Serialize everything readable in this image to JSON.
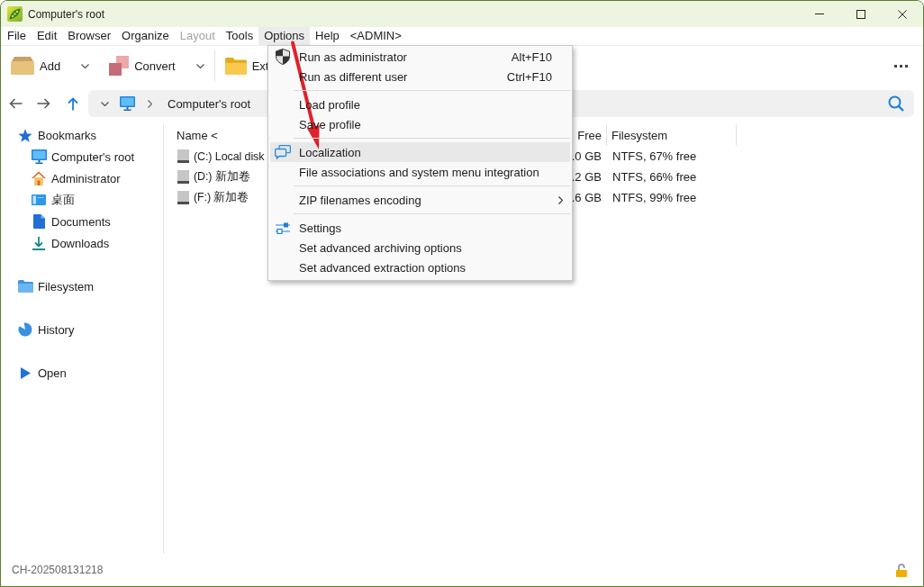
{
  "window": {
    "title": "Computer's root"
  },
  "menu_bar": [
    {
      "label": "File",
      "selected": false,
      "disabled": false
    },
    {
      "label": "Edit",
      "selected": false,
      "disabled": false
    },
    {
      "label": "Browser",
      "selected": false,
      "disabled": false
    },
    {
      "label": "Organize",
      "selected": false,
      "disabled": false
    },
    {
      "label": "Layout",
      "selected": false,
      "disabled": true
    },
    {
      "label": "Tools",
      "selected": false,
      "disabled": false
    },
    {
      "label": "Options",
      "selected": true,
      "disabled": false
    },
    {
      "label": "Help",
      "selected": false,
      "disabled": false
    },
    {
      "label": "<ADMIN>",
      "selected": false,
      "disabled": false
    }
  ],
  "open_menu": {
    "groups": [
      {
        "items": [
          {
            "label": "Run as administrator",
            "shortcut": "Alt+F10",
            "selected": false,
            "submenu": false
          },
          {
            "label": "Run as different user",
            "shortcut": "Ctrl+F10",
            "selected": false,
            "submenu": false
          }
        ]
      },
      {
        "items": [
          {
            "label": "Load profile",
            "selected": false,
            "submenu": false
          },
          {
            "label": "Save profile",
            "selected": false,
            "submenu": false
          }
        ]
      },
      {
        "items": [
          {
            "label": "Localization",
            "selected": true,
            "submenu": false
          },
          {
            "label": "File associations and system menu integration",
            "selected": false,
            "submenu": false
          }
        ]
      },
      {
        "items": [
          {
            "label": "ZIP filenames encoding",
            "selected": false,
            "submenu": true
          }
        ]
      },
      {
        "items": [
          {
            "label": "Settings",
            "selected": false,
            "submenu": false
          },
          {
            "label": "Set advanced archiving options",
            "selected": false,
            "submenu": false
          },
          {
            "label": "Set advanced extraction options",
            "selected": false,
            "submenu": false
          }
        ]
      }
    ]
  },
  "annotations": [
    {
      "kind": "arrow"
    }
  ],
  "toolbar": {
    "groups": [
      {
        "buttons": [
          {
            "label": "Add",
            "dropdown": true
          },
          {
            "label": "Convert",
            "dropdown": true
          }
        ]
      },
      {
        "buttons": [
          {
            "label": "Ext",
            "dropdown": false
          }
        ]
      }
    ]
  },
  "address_bar": {
    "crumbs": [
      "Computer's root"
    ]
  },
  "sidebar": {
    "items": [
      {
        "label": "Bookmarks",
        "children": [
          {
            "label": "Computer's root"
          },
          {
            "label": "Administrator"
          },
          {
            "label": "桌面"
          },
          {
            "label": "Documents"
          },
          {
            "label": "Downloads"
          }
        ]
      },
      {
        "label": "Filesystem"
      },
      {
        "label": "History"
      },
      {
        "label": "Open"
      }
    ]
  },
  "file_list": {
    "columns": [
      {
        "label": "Name <"
      },
      {
        "label": "Free"
      },
      {
        "label": "Filesystem"
      }
    ],
    "rows": [
      {
        "cells": [
          "(C:) Local disk",
          ".0 GB",
          "NTFS, 67% free"
        ]
      },
      {
        "cells": [
          "(D:) 新加卷",
          ".2 GB",
          "NTFS, 66% free"
        ]
      },
      {
        "cells": [
          "(F:) 新加卷",
          ".6 GB",
          "NTFS, 99% free"
        ]
      }
    ]
  },
  "status_bar": {
    "text": "CH-202508131218"
  }
}
